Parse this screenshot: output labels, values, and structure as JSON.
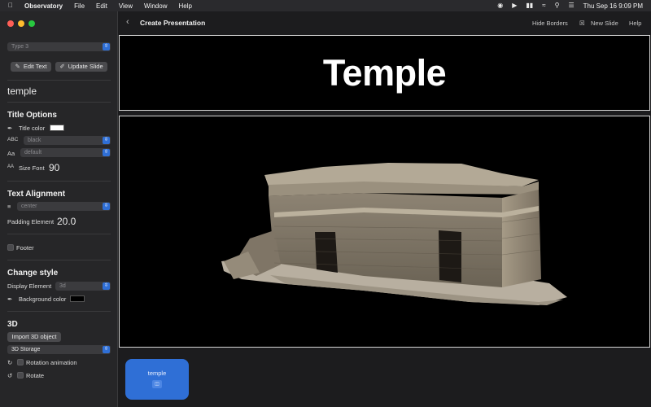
{
  "menubar": {
    "app_name": "Observatory",
    "menus": [
      "File",
      "Edit",
      "View",
      "Window",
      "Help"
    ],
    "datetime": "Thu Sep 16  9:09 PM"
  },
  "sidebar": {
    "type_select": "Type 3",
    "edit_text_label": "Edit Text",
    "update_slide_label": "Update Slide",
    "text_value": "temple",
    "title_options": {
      "heading": "Title Options",
      "title_color_label": "Title color",
      "title_color": "#ffffff",
      "color_select": "black",
      "font_select": "default",
      "size_font_label": "Size Font",
      "size_font_value": "90"
    },
    "text_alignment": {
      "heading": "Text Alignment",
      "alignment_select": "center",
      "padding_label": "Padding Element",
      "padding_value": "20.0"
    },
    "footer_label": "Footer",
    "change_style": {
      "heading": "Change style",
      "display_label": "Display Element",
      "display_select": "3d",
      "background_color_label": "Background color",
      "background_color": "#000000"
    },
    "three_d": {
      "heading": "3D",
      "import_label": "Import 3D object",
      "storage_select": "3D Storage",
      "rotation_animation_label": "Rotation animation",
      "rotate_label": "Rotate"
    }
  },
  "toolbar": {
    "title": "Create Presentation",
    "hide_borders_label": "Hide Borders",
    "new_slide_label": "New Slide",
    "help_label": "Help"
  },
  "slide": {
    "title_text": "Temple"
  },
  "slides_strip": [
    {
      "label": "temple"
    }
  ]
}
